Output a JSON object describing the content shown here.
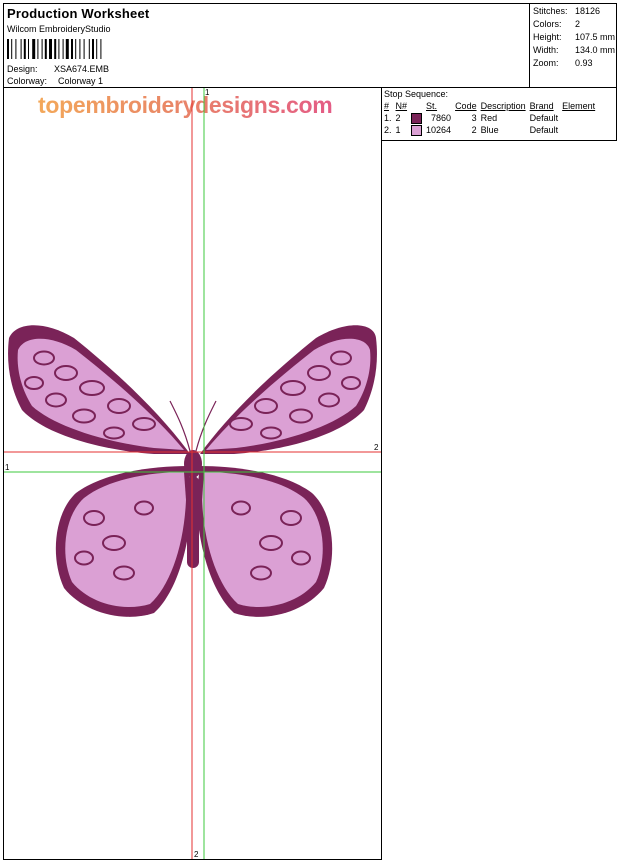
{
  "header": {
    "title": "Production Worksheet",
    "software": "Wilcom EmbroideryStudio",
    "design_label": "Design:",
    "design_value": "XSA674.EMB",
    "colorway_label": "Colorway:",
    "colorway_value": "Colorway 1"
  },
  "stats": [
    {
      "label": "Stitches:",
      "value": "18126"
    },
    {
      "label": "Colors:",
      "value": "2"
    },
    {
      "label": "Height:",
      "value": "107.5 mm"
    },
    {
      "label": "Width:",
      "value": "134.0 mm"
    },
    {
      "label": "Zoom:",
      "value": "0.93"
    }
  ],
  "design_area": {
    "watermark": "topembroiderydesigns.com",
    "axis_labels": {
      "top": "1",
      "right": "2",
      "left": "1",
      "bottom": "2"
    },
    "colors": {
      "dark": "#7a2358",
      "light": "#dba0d4",
      "red_axis": "#e53030",
      "green_axis": "#3cc83c"
    }
  },
  "stop_sequence": {
    "title": "Stop Sequence:",
    "headers": [
      "#",
      "N#",
      "St.",
      "Code",
      "Description",
      "Brand",
      "Element"
    ],
    "rows": [
      {
        "index": "1.",
        "n": "2",
        "color": "#7a2358",
        "stitches": "7860",
        "code": "3",
        "description": "Red",
        "brand": "Default",
        "element": ""
      },
      {
        "index": "2.",
        "n": "1",
        "color": "#dba0d4",
        "stitches": "10264",
        "code": "2",
        "description": "Blue",
        "brand": "Default",
        "element": ""
      }
    ]
  }
}
